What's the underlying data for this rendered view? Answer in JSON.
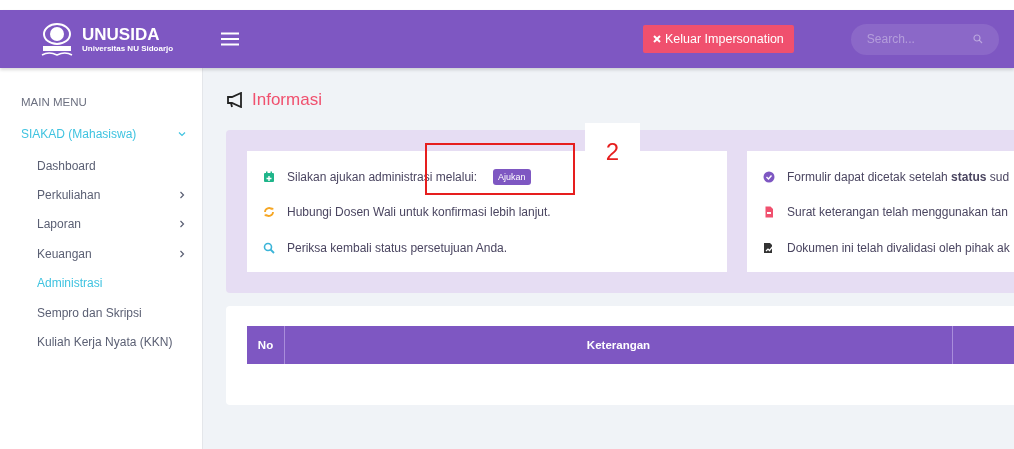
{
  "brand": {
    "name": "UNUSIDA",
    "subtitle": "Universitas NU Sidoarjo"
  },
  "header": {
    "exit_button": "Keluar Impersonation",
    "search": {
      "placeholder": "Search..."
    }
  },
  "sidebar": {
    "heading": "MAIN MENU",
    "groups": [
      {
        "label": "SIAKAD (Mahasiswa)",
        "expanded": true,
        "children": [
          {
            "label": "Dashboard",
            "selected": false
          },
          {
            "label": "Perkuliahan",
            "selected": false,
            "expanded": false
          },
          {
            "label": "Laporan",
            "selected": false,
            "expanded": false
          },
          {
            "label": "Keuangan",
            "selected": false,
            "expanded": false
          },
          {
            "label": "Administrasi",
            "selected": true
          },
          {
            "label": "Sempro dan Skripsi",
            "selected": false
          },
          {
            "label": "Kuliah Kerja Nyata (KKN)",
            "selected": false
          }
        ]
      }
    ]
  },
  "page_title": "Informasi",
  "info_cards": [
    {
      "items": [
        {
          "text": "Silakan ajukan administrasi melalui:",
          "button": "Ajukan"
        },
        {
          "text": "Hubungi Dosen Wali untuk konfirmasi lebih lanjut."
        },
        {
          "text": "Periksa kembali status persetujuan Anda."
        }
      ]
    },
    {
      "items": [
        {
          "text": "Formulir dapat dicetak setelah **status** sud"
        },
        {
          "text": "Surat keterangan telah menggunakan tan"
        },
        {
          "text": "Dokumen ini telah divalidasi oleh pihak ak"
        }
      ]
    }
  ],
  "table": {
    "columns": [
      {
        "label": "No"
      },
      {
        "label": "Keterangan"
      }
    ]
  },
  "annotation": {
    "label": "2"
  }
}
